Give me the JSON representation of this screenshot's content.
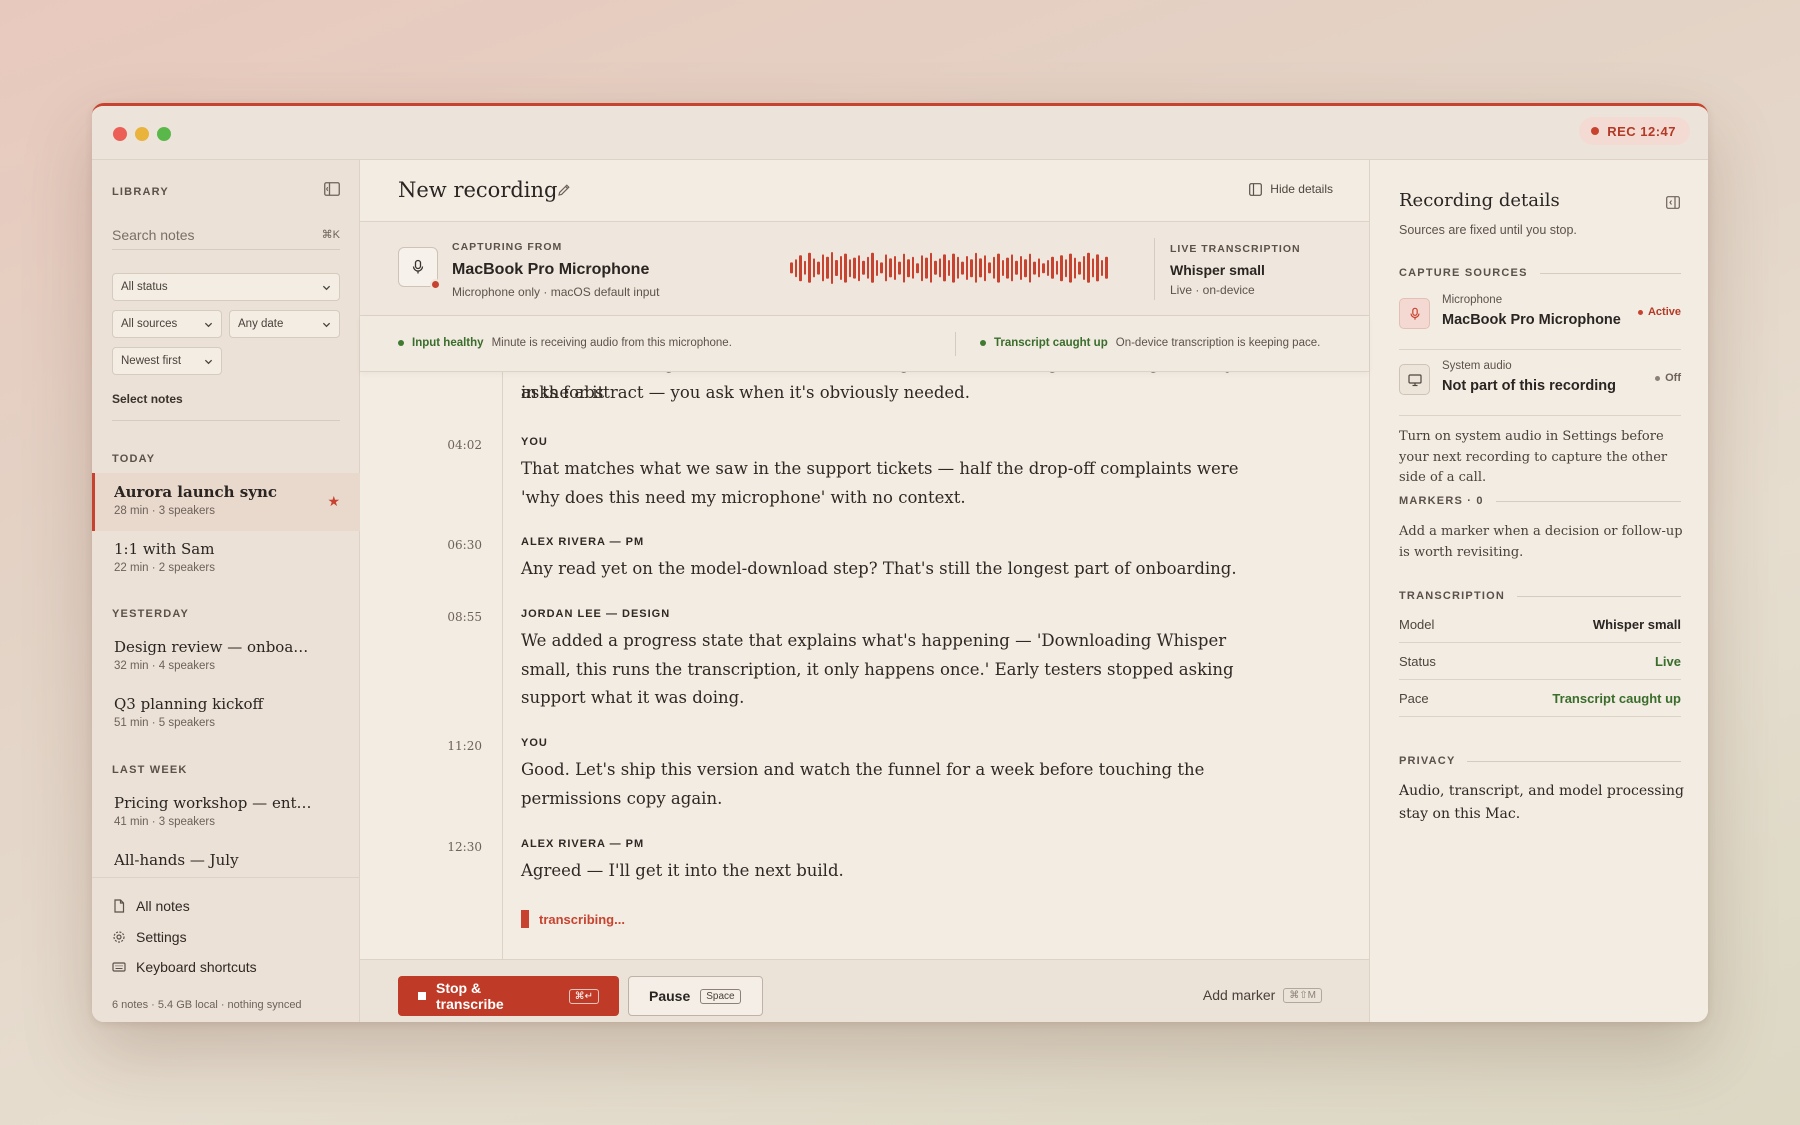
{
  "window": {
    "rec_indicator": "REC 12:47"
  },
  "sidebar": {
    "library_label": "LIBRARY",
    "search": {
      "placeholder": "Search notes",
      "shortcut": "⌘K"
    },
    "filters": {
      "status": "All status",
      "sources": "All sources",
      "date": "Any date",
      "sort": "Newest first"
    },
    "select_notes": "Select notes",
    "groups": [
      {
        "label": "TODAY",
        "notes": [
          {
            "title": "Aurora launch sync",
            "meta": "28 min · 3 speakers",
            "starred": true,
            "active": true
          },
          {
            "title": "1:1 with Sam",
            "meta": "22 min · 2 speakers"
          }
        ]
      },
      {
        "label": "YESTERDAY",
        "notes": [
          {
            "title": "Design review — onboarding",
            "meta": "32 min · 4 speakers"
          },
          {
            "title": "Q3 planning kickoff",
            "meta": "51 min · 5 speakers"
          }
        ]
      },
      {
        "label": "LAST WEEK",
        "notes": [
          {
            "title": "Pricing workshop — enterprise",
            "meta": "41 min · 3 speakers"
          },
          {
            "title": "All-hands — July",
            "meta": ""
          }
        ]
      }
    ],
    "links": {
      "all_notes": "All notes",
      "settings": "Settings",
      "shortcuts": "Keyboard shortcuts"
    },
    "footer": "6 notes · 5.4 GB local · nothing synced"
  },
  "main": {
    "title": "New recording",
    "hide_details": "Hide details",
    "capture": {
      "label": "CAPTURING FROM",
      "device": "MacBook Pro Microphone",
      "sub": "Microphone only · macOS default input",
      "levels": [
        0.35,
        0.55,
        0.8,
        0.45,
        0.95,
        0.6,
        0.4,
        0.85,
        0.7,
        1.0,
        0.5,
        0.75,
        0.9,
        0.55,
        0.65,
        0.8,
        0.45,
        0.7,
        0.95,
        0.5,
        0.35,
        0.85,
        0.6,
        0.75,
        0.4,
        0.9,
        0.55,
        0.7,
        0.3,
        0.8,
        0.65,
        0.95,
        0.45,
        0.6,
        0.85,
        0.5,
        0.9,
        0.7,
        0.4,
        0.75,
        0.55,
        0.95,
        0.6,
        0.8,
        0.35,
        0.7,
        0.9,
        0.5,
        0.65,
        0.85,
        0.45,
        0.75,
        0.55,
        0.9,
        0.4,
        0.6,
        0.3,
        0.5,
        0.7,
        0.45,
        0.8,
        0.55,
        0.9,
        0.65,
        0.4,
        0.75,
        0.95,
        0.6,
        0.85,
        0.5,
        0.7
      ]
    },
    "live": {
      "label": "LIVE TRANSCRIPTION",
      "model": "Whisper small",
      "sub": "Live · on-device"
    },
    "health": {
      "input_title": "Input healthy",
      "input_desc": "Minute is receiving audio from this microphone.",
      "transcript_title": "Transcript caught up",
      "transcript_desc": "On-device transcription is keeping pace."
    },
    "transcript": {
      "partial_top_1": "We moved it to right before the first recording instead of during onboarding. Nobody asks for it",
      "partial_top_2": "in the abstract — you ask when it's obviously needed.",
      "segments": [
        {
          "time": "04:02",
          "speaker": "YOU",
          "text": "That matches what we saw in the support tickets — half the drop-off complaints were 'why does this need my microphone' with no context."
        },
        {
          "time": "06:30",
          "speaker": "ALEX RIVERA — PM",
          "text": "Any read yet on the model-download step? That's still the longest part of onboarding."
        },
        {
          "time": "08:55",
          "speaker": "JORDAN LEE — DESIGN",
          "text": "We added a progress state that explains what's happening — 'Downloading Whisper small, this runs the transcription, it only happens once.' Early testers stopped asking support what it was doing."
        },
        {
          "time": "11:20",
          "speaker": "YOU",
          "text": "Good. Let's ship this version and watch the funnel for a week before touching the permissions copy again."
        },
        {
          "time": "12:30",
          "speaker": "ALEX RIVERA — PM",
          "text": "Agreed — I'll get it into the next build."
        }
      ],
      "transcribing": "transcribing..."
    },
    "footer": {
      "stop_label": "Stop & transcribe",
      "stop_kbd": "⌘↵",
      "pause_label": "Pause",
      "pause_kbd": "Space",
      "marker_label": "Add marker",
      "marker_kbd": "⌘⇧M"
    }
  },
  "details": {
    "title": "Recording details",
    "sub": "Sources are fixed until you stop.",
    "capture_sources_label": "CAPTURE SOURCES",
    "sources": [
      {
        "kind": "Microphone",
        "name": "MacBook Pro Microphone",
        "status": "Active"
      },
      {
        "kind": "System audio",
        "name": "Not part of this recording",
        "status": "Off"
      }
    ],
    "system_audio_note": "Turn on system audio in Settings before your next recording to capture the other side of a call.",
    "markers_label": "MARKERS · 0",
    "markers_note": "Add a marker when a decision or follow-up is worth revisiting.",
    "transcription_label": "TRANSCRIPTION",
    "transcription": [
      {
        "key": "Model",
        "value": "Whisper small"
      },
      {
        "key": "Status",
        "value": "Live"
      },
      {
        "key": "Pace",
        "value": "Transcript caught up"
      }
    ],
    "privacy_label": "PRIVACY",
    "privacy_text": "Audio, transcript, and model processing stay on this Mac."
  },
  "colors": {
    "accent": "#c8432f",
    "healthy": "#3f7a31",
    "background": "#f2ece3"
  }
}
